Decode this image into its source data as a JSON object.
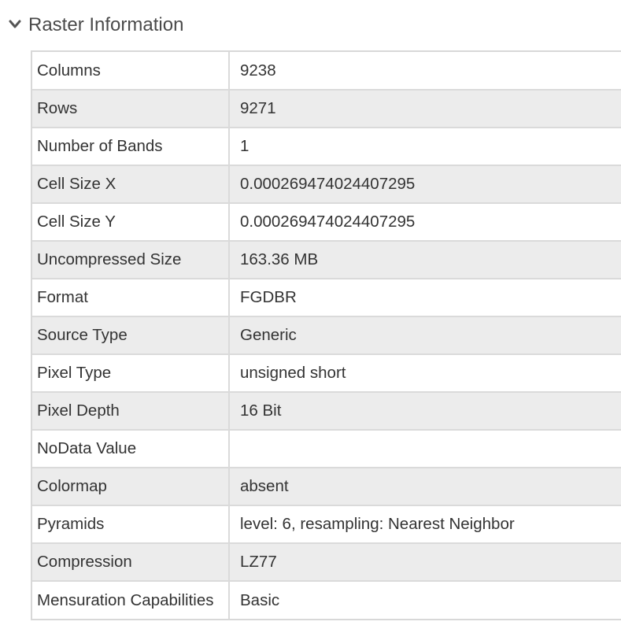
{
  "section": {
    "title": "Raster Information",
    "toggle_icon": "chevron-down-icon"
  },
  "rows": [
    {
      "label": "Columns",
      "value": "9238"
    },
    {
      "label": "Rows",
      "value": "9271"
    },
    {
      "label": "Number of Bands",
      "value": "1"
    },
    {
      "label": "Cell Size X",
      "value": "0.000269474024407295"
    },
    {
      "label": "Cell Size Y",
      "value": "0.000269474024407295"
    },
    {
      "label": "Uncompressed Size",
      "value": "163.36 MB"
    },
    {
      "label": "Format",
      "value": "FGDBR"
    },
    {
      "label": "Source Type",
      "value": "Generic"
    },
    {
      "label": "Pixel Type",
      "value": "unsigned short"
    },
    {
      "label": "Pixel Depth",
      "value": "16 Bit"
    },
    {
      "label": "NoData Value",
      "value": ""
    },
    {
      "label": "Colormap",
      "value": "absent"
    },
    {
      "label": "Pyramids",
      "value": "level: 6, resampling: Nearest Neighbor"
    },
    {
      "label": "Compression",
      "value": "LZ77"
    },
    {
      "label": "Mensuration Capabilities",
      "value": "Basic"
    }
  ],
  "colors": {
    "title": "#4a4a4a",
    "alt_row": "#ececec",
    "border": "#dadada"
  }
}
